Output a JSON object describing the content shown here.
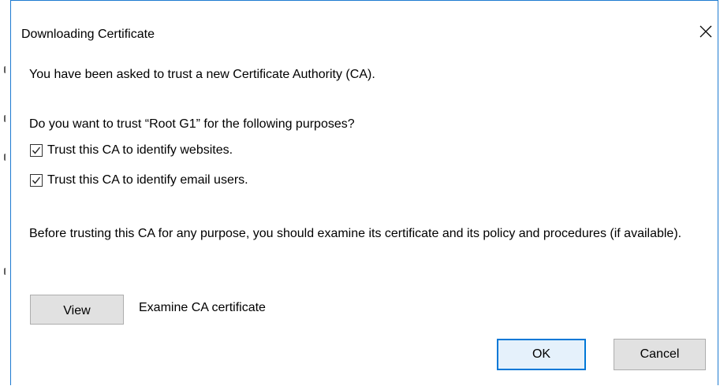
{
  "dialog": {
    "title": "Downloading Certificate",
    "close_glyph": "✕"
  },
  "message": {
    "intro": "You have been asked to trust a new Certificate Authority (CA).",
    "question": "Do you want to trust “Root G1” for the following purposes?",
    "advice": "Before trusting this CA for any purpose, you should examine its certificate and its policy and procedures (if available)."
  },
  "options": [
    {
      "label": "Trust this CA to identify websites.",
      "checked": true
    },
    {
      "label": "Trust this CA to identify email users.",
      "checked": true
    }
  ],
  "view": {
    "button_label": "View",
    "description": "Examine CA certificate"
  },
  "buttons": {
    "ok_label": "OK",
    "cancel_label": "Cancel"
  },
  "colors": {
    "accent": "#0078d7",
    "window_border": "#1e7bd0",
    "button_face": "#e1e1e1",
    "default_button_face": "#e5f1fb"
  },
  "icons": {
    "close": "close-icon",
    "checkmark": "checkmark-icon"
  }
}
